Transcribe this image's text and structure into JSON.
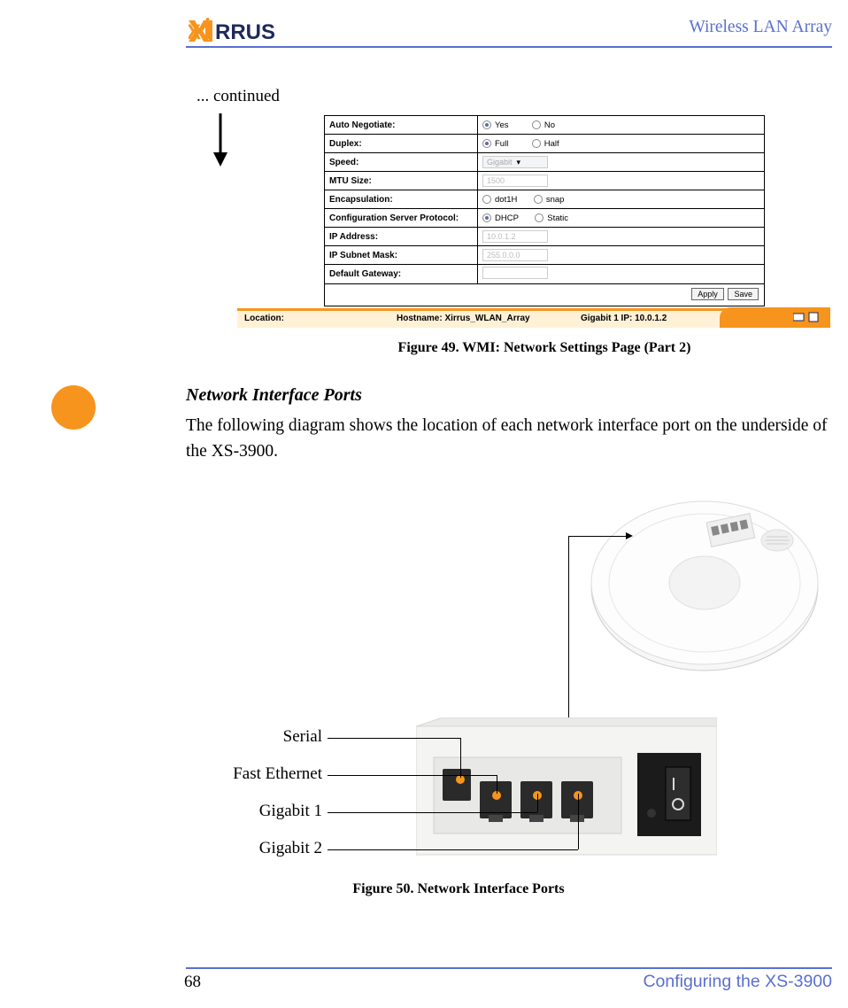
{
  "header": {
    "brand": "XIRRUS",
    "title": "Wireless LAN Array"
  },
  "continued_label": "... continued",
  "wmi": {
    "rows": [
      {
        "label": "Auto Negotiate:",
        "opt1": "Yes",
        "opt2": "No",
        "sel": 1,
        "type": "radio"
      },
      {
        "label": "Duplex:",
        "opt1": "Full",
        "opt2": "Half",
        "sel": 1,
        "type": "radio"
      },
      {
        "label": "Speed:",
        "val": "Gigabit",
        "type": "select"
      },
      {
        "label": "MTU Size:",
        "val": "1500",
        "type": "text_disabled"
      },
      {
        "label": "Encapsulation:",
        "opt1": "dot1H",
        "opt2": "snap",
        "sel": 0,
        "type": "radio_open"
      },
      {
        "label": "Configuration Server Protocol:",
        "opt1": "DHCP",
        "opt2": "Static",
        "sel": 1,
        "type": "radio"
      },
      {
        "label": "IP Address:",
        "val": "10.0.1.2",
        "type": "text_disabled"
      },
      {
        "label": "IP Subnet Mask:",
        "val": "255.0.0.0",
        "type": "text_disabled"
      },
      {
        "label": "Default Gateway:",
        "val": "",
        "type": "text"
      }
    ],
    "apply_btn": "Apply",
    "save_btn": "Save",
    "location_bar": {
      "location": "Location:",
      "hostname": "Hostname: Xirrus_WLAN_Array",
      "ip": "Gigabit 1 IP: 10.0.1.2"
    }
  },
  "caption49": "Figure 49. WMI: Network Settings Page (Part 2)",
  "section_title": "Network Interface Ports",
  "body_text": "The following diagram shows the location of each network interface port on the underside of the XS-3900.",
  "port_labels": {
    "serial": "Serial",
    "fast_ethernet": "Fast Ethernet",
    "gigabit1": "Gigabit 1",
    "gigabit2": "Gigabit 2"
  },
  "caption50": "Figure 50. Network Interface Ports",
  "footer": {
    "page_num": "68",
    "section": "Configuring the XS-3900"
  }
}
